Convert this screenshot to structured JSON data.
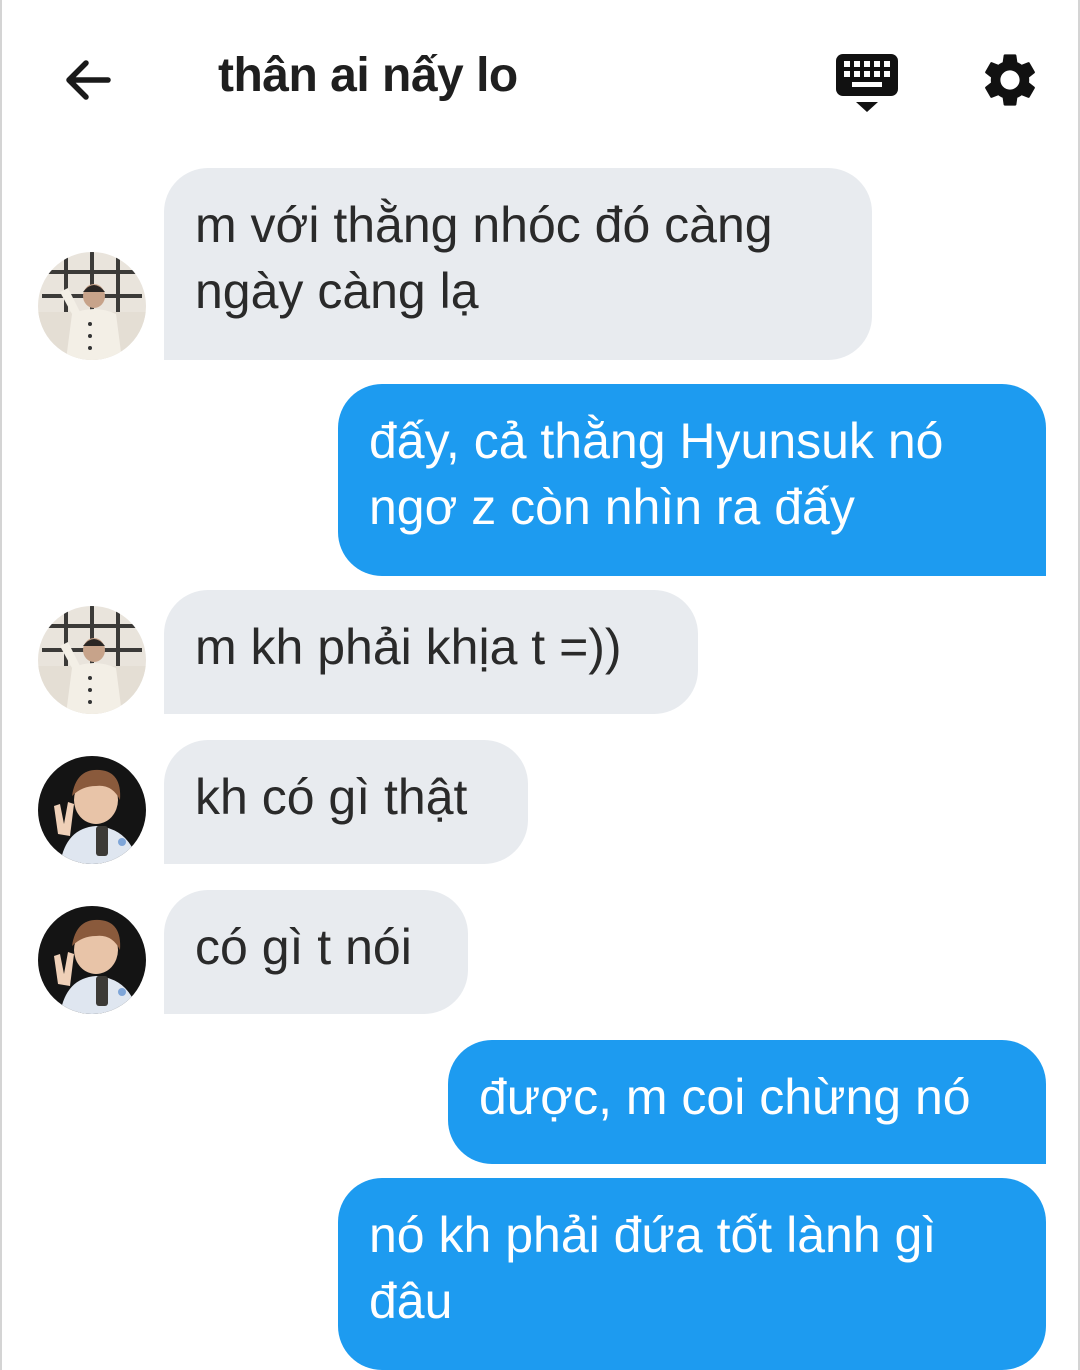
{
  "header": {
    "title": "thân ai nấy lo",
    "back_icon": "arrow-left-icon",
    "keyboard_icon": "keyboard-icon",
    "settings_icon": "gear-icon"
  },
  "colors": {
    "outgoing": "#1d9bf0",
    "incoming": "#e8ebef"
  },
  "messages": [
    {
      "side": "in",
      "avatar": "avatar-1",
      "text_lines": [
        "m với thằng nhóc đó càng",
        "ngày càng lạ"
      ]
    },
    {
      "side": "out",
      "text_lines": [
        "đấy, cả thằng Hyunsuk nó",
        "ngơ z còn nhìn ra đấy"
      ]
    },
    {
      "side": "in",
      "avatar": "avatar-1",
      "text_lines": [
        "m kh phải khịa t =))"
      ]
    },
    {
      "side": "in",
      "avatar": "avatar-2",
      "text_lines": [
        "kh có gì thật"
      ]
    },
    {
      "side": "in",
      "avatar": "avatar-2",
      "text_lines": [
        "có gì t nói"
      ]
    },
    {
      "side": "out",
      "text_lines": [
        "được, m coi chừng nó"
      ]
    },
    {
      "side": "out",
      "text_lines": [
        "nó kh phải đứa tốt lành gì",
        "đâu"
      ]
    }
  ]
}
